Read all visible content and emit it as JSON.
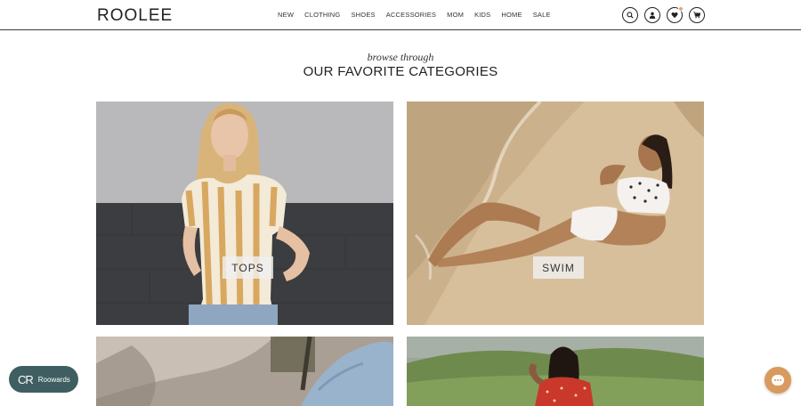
{
  "header": {
    "logo": "ROOLEE",
    "nav": [
      "NEW",
      "CLOTHING",
      "SHOES",
      "ACCESSORIES",
      "MOM",
      "KIDS",
      "HOME",
      "SALE"
    ],
    "icons": [
      "search-icon",
      "account-icon",
      "wishlist-heart-icon",
      "cart-icon"
    ]
  },
  "section": {
    "subtitle": "browse through",
    "title": "OUR FAVORITE CATEGORIES"
  },
  "categories": [
    {
      "label": "TOPS"
    },
    {
      "label": "SWIM"
    }
  ],
  "widgets": {
    "rewards_label": "Roowards",
    "rewards_logo": "CR",
    "chat_icon": "chat-bubble-icon"
  },
  "colors": {
    "rewards_bg": "#3f5e61",
    "chat_bg": "#d99a5e",
    "accent_badge": "#e0a87a"
  }
}
